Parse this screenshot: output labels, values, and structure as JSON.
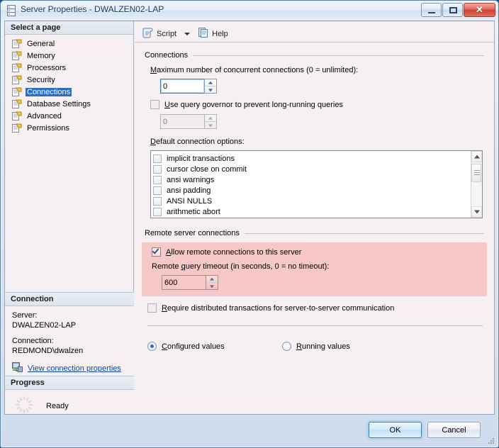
{
  "window": {
    "title": "Server Properties - DWALZEN02-LAP",
    "icon": "server-icon",
    "minimize_label": "Minimize",
    "maximize_label": "Maximize",
    "close_label": "Close"
  },
  "sidebar": {
    "header": "Select a page",
    "items": [
      {
        "label": "General",
        "selected": false
      },
      {
        "label": "Memory",
        "selected": false
      },
      {
        "label": "Processors",
        "selected": false
      },
      {
        "label": "Security",
        "selected": false
      },
      {
        "label": "Connections",
        "selected": true
      },
      {
        "label": "Database Settings",
        "selected": false
      },
      {
        "label": "Advanced",
        "selected": false
      },
      {
        "label": "Permissions",
        "selected": false
      }
    ],
    "connection": {
      "header": "Connection",
      "server_label": "Server:",
      "server_value": "DWALZEN02-LAP",
      "connection_label": "Connection:",
      "connection_value": "REDMOND\\dwalzen",
      "link_text": "View connection properties"
    },
    "progress": {
      "header": "Progress",
      "status": "Ready"
    }
  },
  "toolbar": {
    "script_label": "Script",
    "help_label": "Help"
  },
  "connections_group": {
    "title": "Connections",
    "max_connections_label_pre": "M",
    "max_connections_label_post": "aximum number of concurrent connections (0 = unlimited):",
    "max_connections_value": "0",
    "query_governor_pre": "U",
    "query_governor_post": "se query governor to prevent long-running queries",
    "query_governor_checked": false,
    "query_governor_value": "0",
    "default_options_pre": "D",
    "default_options_post": "efault connection options:",
    "options": [
      {
        "label": "implicit transactions",
        "checked": false
      },
      {
        "label": "cursor close on commit",
        "checked": false
      },
      {
        "label": "ansi warnings",
        "checked": false
      },
      {
        "label": "ansi padding",
        "checked": false
      },
      {
        "label": "ANSI NULLS",
        "checked": false
      },
      {
        "label": "arithmetic abort",
        "checked": false
      }
    ]
  },
  "remote_group": {
    "title": "Remote server connections",
    "allow_remote_pre": "A",
    "allow_remote_post": "llow remote connections to this server",
    "allow_remote_checked": true,
    "timeout_label_a": "Remote ",
    "timeout_label_b": "q",
    "timeout_label_c": "uery timeout (in seconds, 0 = no timeout):",
    "timeout_value": "600",
    "require_dtc_pre": "R",
    "require_dtc_mid": "e",
    "require_dtc_post": "quire distributed transactions for server-to-server communication",
    "require_dtc_checked": false,
    "highlight_color": "#f7c8c8"
  },
  "values_mode": {
    "configured_pre": "C",
    "configured_post": "onfigured values",
    "running_pre": "R",
    "running_post": "unning values",
    "selected": "configured"
  },
  "footer": {
    "ok_label": "OK",
    "cancel_label": "Cancel"
  }
}
